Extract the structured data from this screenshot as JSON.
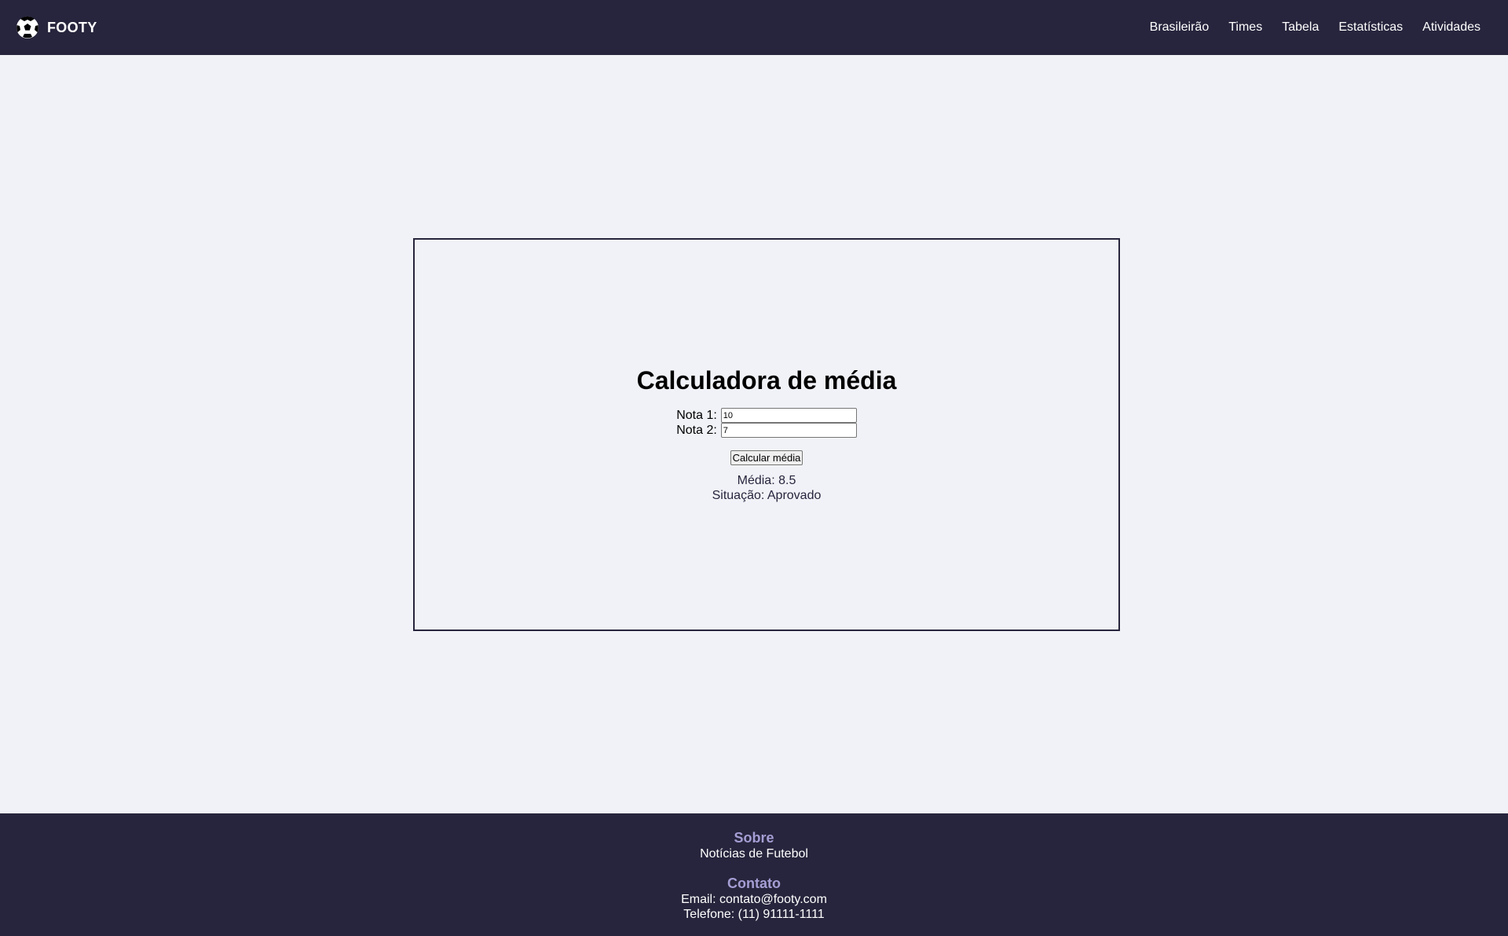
{
  "navbar": {
    "brand": "FOOTY",
    "logo_icon": "soccer-ball-icon",
    "links": [
      "Brasileirão",
      "Times",
      "Tabela",
      "Estatísticas",
      "Atividades"
    ]
  },
  "calculator": {
    "title": "Calculadora de média",
    "nota1_label": "Nota 1:",
    "nota1_value": "10",
    "nota2_label": "Nota 2:",
    "nota2_value": "7",
    "button_label": "Calcular média",
    "media_text": "Média: 8.5",
    "situacao_text": "Situação: Aprovado"
  },
  "footer": {
    "about_heading": "Sobre",
    "about_text": "Notícias de Futebol",
    "contact_heading": "Contato",
    "email": "Email: contato@footy.com",
    "phone": "Telefone: (11) 91111-1111"
  },
  "colors": {
    "navbar_bg": "#27253d",
    "page_bg": "#f0f2f7",
    "footer_heading": "#a59ed4"
  }
}
